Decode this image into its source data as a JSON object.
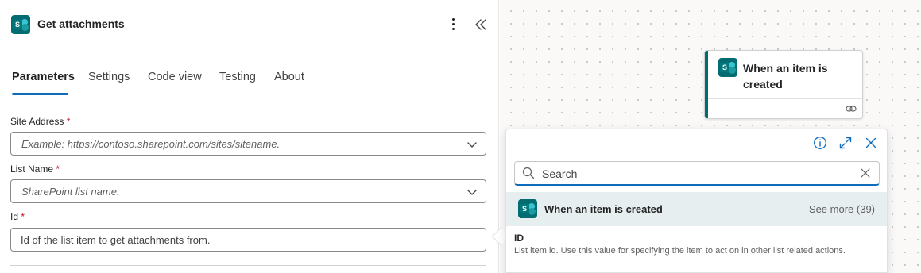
{
  "panel": {
    "title": "Get attachments",
    "tabs": [
      {
        "label": "Parameters",
        "active": true
      },
      {
        "label": "Settings",
        "active": false
      },
      {
        "label": "Code view",
        "active": false
      },
      {
        "label": "Testing",
        "active": false
      },
      {
        "label": "About",
        "active": false
      }
    ],
    "fields": [
      {
        "label": "Site Address",
        "required_mark": "*",
        "placeholder": "Example: https://contoso.sharepoint.com/sites/sitename.",
        "type": "dropdown"
      },
      {
        "label": "List Name",
        "required_mark": "*",
        "placeholder": "SharePoint list name.",
        "type": "dropdown"
      },
      {
        "label": "Id",
        "required_mark": "*",
        "value": "Id of the list item to get attachments from.",
        "type": "text"
      }
    ]
  },
  "canvas": {
    "trigger_card": {
      "title": "When an item is created"
    }
  },
  "dynamic_content": {
    "search": {
      "placeholder": "Search"
    },
    "group": {
      "label": "When an item is created",
      "see_more": "See more (39)"
    },
    "item": {
      "title": "ID",
      "description": "List item id. Use this value for specifying the item to act on in other list related actions."
    }
  },
  "colors": {
    "sharepoint_teal": "#036c70",
    "accent_blue": "#0f6cbd",
    "required_red": "#c50f1f",
    "group_bg": "#e7eeef"
  },
  "icons": {
    "connector": "sharepoint-icon",
    "menu": "more-vertical-icon",
    "collapse": "double-chevron-left-icon",
    "dropdown": "chevron-down-icon",
    "info": "info-icon",
    "expand": "expand-icon",
    "close": "close-icon",
    "search": "search-icon",
    "clear": "clear-icon",
    "link": "link-icon"
  }
}
